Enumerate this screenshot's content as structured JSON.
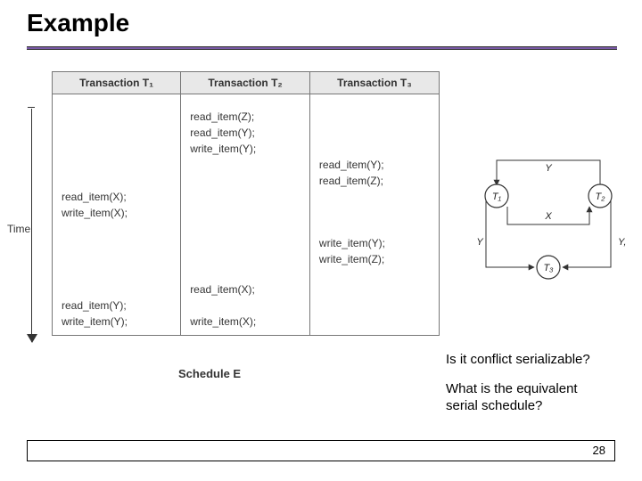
{
  "title": "Example",
  "time_label": "Time",
  "table": {
    "headers": [
      "Transaction T₁",
      "Transaction T₂",
      "Transaction T₃"
    ],
    "rows": [
      [
        "",
        "",
        ""
      ],
      [
        "",
        "read_item(Z);",
        ""
      ],
      [
        "",
        "read_item(Y);",
        ""
      ],
      [
        "",
        "write_item(Y);",
        ""
      ],
      [
        "",
        "",
        "read_item(Y);"
      ],
      [
        "",
        "",
        "read_item(Z);"
      ],
      [
        "read_item(X);",
        "",
        ""
      ],
      [
        "write_item(X);",
        "",
        ""
      ],
      [
        "",
        "",
        ""
      ],
      [
        "",
        "",
        "write_item(Y);"
      ],
      [
        "",
        "",
        "write_item(Z);"
      ],
      [
        "",
        "",
        ""
      ],
      [
        "",
        "read_item(X);",
        ""
      ],
      [
        "read_item(Y);",
        "",
        ""
      ],
      [
        "write_item(Y);",
        "write_item(X);",
        ""
      ]
    ],
    "caption": "Schedule E"
  },
  "graph": {
    "nodes": [
      "T₁",
      "T₂",
      "T₃"
    ],
    "edges": [
      {
        "label": "Y"
      },
      {
        "label": "X"
      },
      {
        "label": "Y"
      },
      {
        "label": "Y, Z"
      }
    ]
  },
  "question1": "Is it conflict serializable?",
  "question2a": "What is the equivalent",
  "question2b": "serial schedule?",
  "page_number": "28"
}
